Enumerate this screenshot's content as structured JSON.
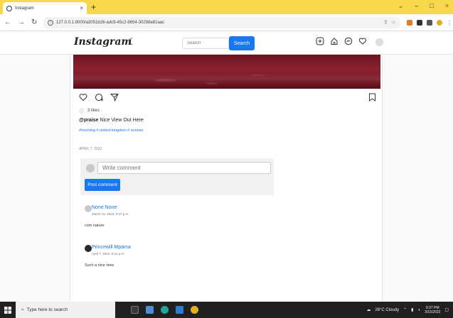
{
  "browser": {
    "tab_title": "Instagram",
    "tab_close": "×",
    "new_tab": "+",
    "url": "127.0.0.1:8000/a3051b26-adc9-45c2-9654-30298e81aac",
    "window_controls": {
      "list": "⌄",
      "minimize": "–",
      "maximize": "□",
      "close": "×"
    }
  },
  "app": {
    "logo": "Instagram",
    "search_placeholder": "Search",
    "search_button": "Search"
  },
  "post": {
    "likes": "3 likes",
    "username": "@praise",
    "caption": "Nice View Out Here",
    "tags": "#morning # united-kingdom # sunrise",
    "date": "APRIL 7, 2022",
    "comment_placeholder": "Write comment",
    "post_comment_button": "Post comment"
  },
  "comments": [
    {
      "name": "None None",
      "time": "March 15, 2023, 9:07 p.m.",
      "text": "com nature"
    },
    {
      "name": "Princewill Mpama",
      "time": "April 7, 2022, 5:21 p.m.",
      "text": "Such a nice view"
    }
  ],
  "taskbar": {
    "search_placeholder": "Type here to search",
    "weather": "26°C Cloudy",
    "time": "9:37 PM",
    "date": "3/15/2023"
  }
}
